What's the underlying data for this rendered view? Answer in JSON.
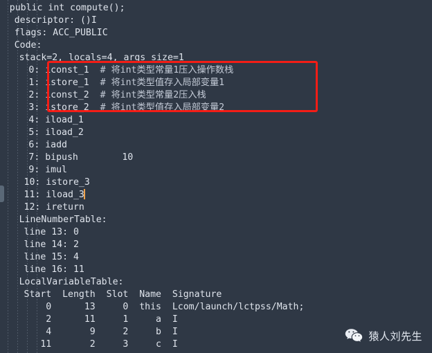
{
  "editor": {
    "theme": {
      "background": "#2f3845",
      "foreground": "#d8dee9",
      "comment": "#c3cad6",
      "caret": "#f0a24a",
      "annotation_box": "#f41d16",
      "indent_guide": "#6a7482",
      "gutter_marker": "#5a6877"
    },
    "lines": [
      {
        "indent": 2,
        "text": "public int compute();"
      },
      {
        "indent": 3,
        "text": "descriptor: ()I"
      },
      {
        "indent": 3,
        "text": "flags: ACC_PUBLIC"
      },
      {
        "indent": 3,
        "text": "Code:"
      },
      {
        "indent": 4,
        "text": "stack=2, locals=4, args size=1"
      },
      {
        "indent": 6,
        "text": "0: iconst_1  # 将int类型常量1压入操作数栈"
      },
      {
        "indent": 6,
        "text": "1: istore_1  # 将int类型值存入局部变量1"
      },
      {
        "indent": 6,
        "text": "2: iconst_2  # 将int类型常量2压入栈"
      },
      {
        "indent": 6,
        "text": "3: istore_2  # 将int类型值存入局部变量2"
      },
      {
        "indent": 6,
        "text": "4: iload_1"
      },
      {
        "indent": 6,
        "text": "5: iload_2"
      },
      {
        "indent": 6,
        "text": "6: iadd"
      },
      {
        "indent": 6,
        "text": "7: bipush        10"
      },
      {
        "indent": 6,
        "text": "9: imul"
      },
      {
        "indent": 5,
        "text": "10: istore_3"
      },
      {
        "indent": 5,
        "text": "11: iload_3"
      },
      {
        "indent": 5,
        "text": "12: ireturn"
      },
      {
        "indent": 4,
        "text": "LineNumberTable:"
      },
      {
        "indent": 5,
        "text": "line 13: 0"
      },
      {
        "indent": 5,
        "text": "line 14: 2"
      },
      {
        "indent": 5,
        "text": "line 15: 4"
      },
      {
        "indent": 5,
        "text": "line 16: 11"
      },
      {
        "indent": 4,
        "text": "LocalVariableTable:"
      },
      {
        "indent": 5,
        "text": "Start  Length  Slot  Name  Signature"
      },
      {
        "indent": 5,
        "text": "    0      13     0  this  Lcom/launch/lctpss/Math;"
      },
      {
        "indent": 5,
        "text": "    2      11     1     a  I"
      },
      {
        "indent": 5,
        "text": "    4       9     2     b  I"
      },
      {
        "indent": 5,
        "text": "   11       2     3     c  I"
      }
    ],
    "bytecode_instructions": [
      {
        "offset": "0",
        "opcode": "iconst_1",
        "operand": "",
        "comment": "将int类型常量1压入操作数栈"
      },
      {
        "offset": "1",
        "opcode": "istore_1",
        "operand": "",
        "comment": "将int类型值存入局部变量1"
      },
      {
        "offset": "2",
        "opcode": "iconst_2",
        "operand": "",
        "comment": "将int类型常量2压入栈"
      },
      {
        "offset": "3",
        "opcode": "istore_2",
        "operand": "",
        "comment": "将int类型值存入局部变量2"
      },
      {
        "offset": "4",
        "opcode": "iload_1",
        "operand": "",
        "comment": ""
      },
      {
        "offset": "5",
        "opcode": "iload_2",
        "operand": "",
        "comment": ""
      },
      {
        "offset": "6",
        "opcode": "iadd",
        "operand": "",
        "comment": ""
      },
      {
        "offset": "7",
        "opcode": "bipush",
        "operand": "10",
        "comment": ""
      },
      {
        "offset": "9",
        "opcode": "imul",
        "operand": "",
        "comment": ""
      },
      {
        "offset": "10",
        "opcode": "istore_3",
        "operand": "",
        "comment": ""
      },
      {
        "offset": "11",
        "opcode": "iload_3",
        "operand": "",
        "comment": ""
      },
      {
        "offset": "12",
        "opcode": "ireturn",
        "operand": "",
        "comment": ""
      }
    ],
    "line_number_table": [
      {
        "line": "13",
        "offset": "0"
      },
      {
        "line": "14",
        "offset": "2"
      },
      {
        "line": "15",
        "offset": "4"
      },
      {
        "line": "16",
        "offset": "11"
      }
    ],
    "local_variable_table": {
      "headers": [
        "Start",
        "Length",
        "Slot",
        "Name",
        "Signature"
      ],
      "rows": [
        [
          "0",
          "13",
          "0",
          "this",
          "Lcom/launch/lctpss/Math;"
        ],
        [
          "2",
          "11",
          "1",
          "a",
          "I"
        ],
        [
          "4",
          "9",
          "2",
          "b",
          "I"
        ],
        [
          "11",
          "2",
          "3",
          "c",
          "I"
        ]
      ]
    },
    "method": {
      "signature": "public int compute();",
      "descriptor": "()I",
      "flags": "ACC_PUBLIC",
      "stack": "2",
      "locals": "4",
      "args_size": "1"
    }
  },
  "annotation": {
    "type": "red-rectangle-highlight",
    "covers": "instructions 0-3"
  },
  "watermark": {
    "icon": "wechat-icon",
    "label": "猿人刘先生"
  }
}
